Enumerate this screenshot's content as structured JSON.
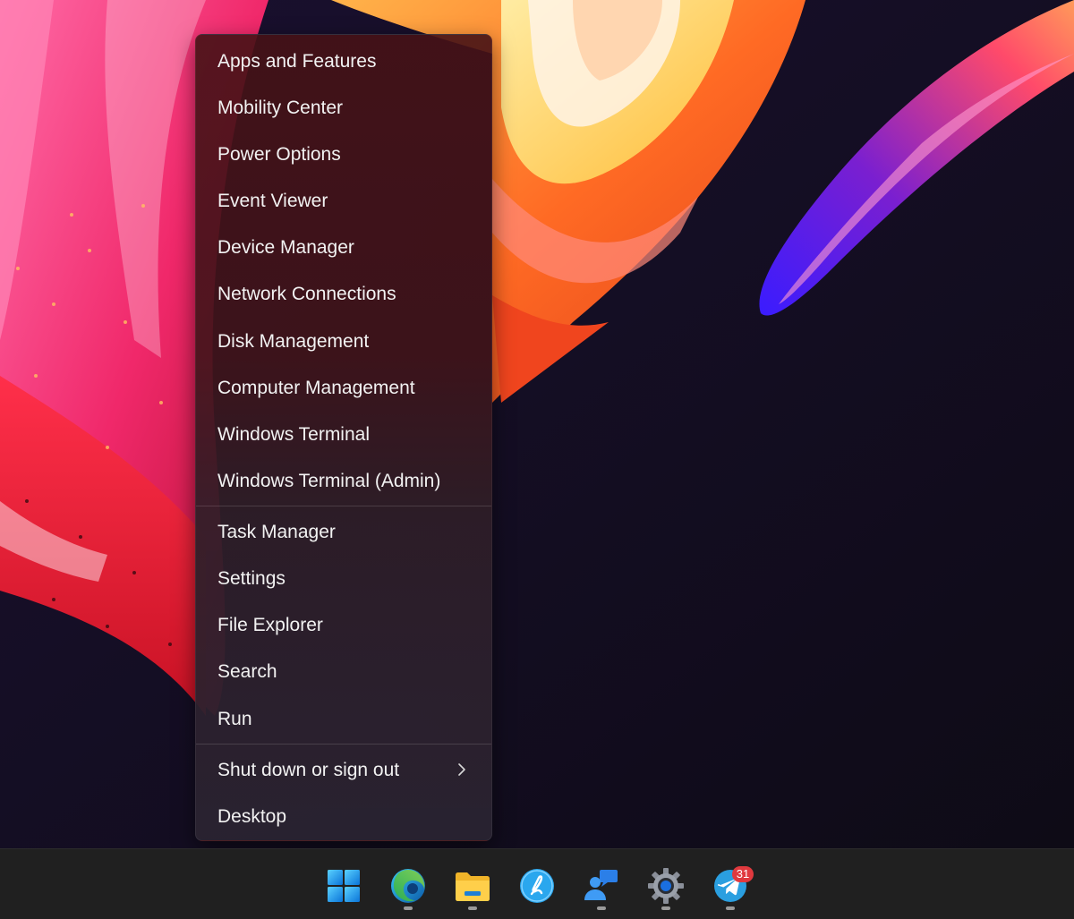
{
  "menu": {
    "items": [
      {
        "label": "Apps and Features"
      },
      {
        "label": "Mobility Center"
      },
      {
        "label": "Power Options"
      },
      {
        "label": "Event Viewer"
      },
      {
        "label": "Device Manager"
      },
      {
        "label": "Network Connections"
      },
      {
        "label": "Disk Management"
      },
      {
        "label": "Computer Management"
      },
      {
        "label": "Windows Terminal"
      },
      {
        "label": "Windows Terminal (Admin)"
      },
      {
        "label": "Task Manager"
      },
      {
        "label": "Settings"
      },
      {
        "label": "File Explorer"
      },
      {
        "label": "Search"
      },
      {
        "label": "Run"
      },
      {
        "label": "Shut down or sign out",
        "has_submenu": true
      },
      {
        "label": "Desktop"
      }
    ]
  },
  "taskbar": {
    "icons": [
      {
        "name": "start-button",
        "icon": "windows-logo-icon",
        "running": false
      },
      {
        "name": "edge",
        "icon": "edge-icon",
        "running": true
      },
      {
        "name": "file-explorer",
        "icon": "folder-icon",
        "running": true
      },
      {
        "name": "app-blue-circle",
        "icon": "blue-circle-app-icon",
        "running": false
      },
      {
        "name": "chat-app",
        "icon": "chat-person-icon",
        "running": true
      },
      {
        "name": "settings",
        "icon": "gear-icon",
        "running": true
      },
      {
        "name": "telegram",
        "icon": "telegram-icon",
        "running": true
      }
    ],
    "telegram_badge": "31"
  },
  "colors": {
    "taskbar_bg": "#202020",
    "menu_text": "#f2f2f2",
    "accent_blue": "#1e90e8",
    "badge_red": "#e0393e"
  }
}
